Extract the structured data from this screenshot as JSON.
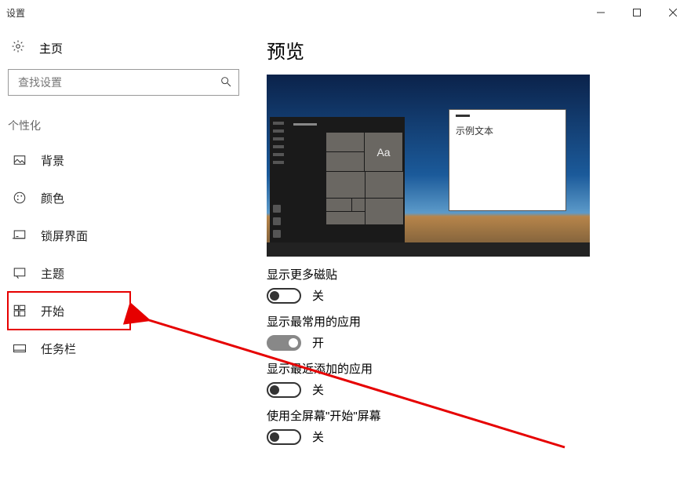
{
  "window": {
    "title": "设置"
  },
  "home": {
    "label": "主页"
  },
  "search": {
    "placeholder": "查找设置"
  },
  "section_label": "个性化",
  "nav": {
    "background": "背景",
    "colors": "颜色",
    "lockscreen": "锁屏界面",
    "themes": "主题",
    "start": "开始",
    "taskbar": "任务栏"
  },
  "main": {
    "title": "预览",
    "preview_sample_text": "示例文本",
    "preview_tile_text": "Aa",
    "settings": {
      "more_tiles": {
        "label": "显示更多磁贴",
        "on": false,
        "state": "关"
      },
      "most_used": {
        "label": "显示最常用的应用",
        "on": true,
        "state": "开"
      },
      "recent_apps": {
        "label": "显示最近添加的应用",
        "on": false,
        "state": "关"
      },
      "fullscreen": {
        "label": "使用全屏幕\"开始\"屏幕",
        "on": false,
        "state": "关"
      }
    }
  }
}
